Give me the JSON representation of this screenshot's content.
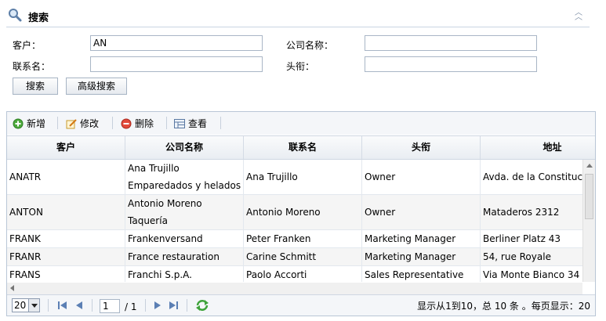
{
  "search": {
    "title": "搜索",
    "customer_label": "客户：",
    "customer_value": "AN",
    "company_label": "公司名称：",
    "company_value": "",
    "contact_label": "联系名：",
    "contact_value": "",
    "title_label": "头衔：",
    "title_value": "",
    "search_button": "搜索",
    "advanced_button": "高级搜索"
  },
  "toolbar": {
    "add": "新增",
    "edit": "修改",
    "delete": "删除",
    "view": "查看"
  },
  "columns": [
    "客户",
    "公司名称",
    "联系名",
    "头衔",
    "地址"
  ],
  "rows": [
    {
      "customer": "ANATR",
      "company": "Ana Trujillo Emparedados y helados",
      "contact": "Ana Trujillo",
      "title": "Owner",
      "address": "Avda. de la Constitución"
    },
    {
      "customer": "ANTON",
      "company": "Antonio Moreno Taquería",
      "contact": "Antonio Moreno",
      "title": "Owner",
      "address": "Mataderos 2312"
    },
    {
      "customer": "FRANK",
      "company": "Frankenversand",
      "contact": "Peter Franken",
      "title": "Marketing Manager",
      "address": "Berliner Platz 43"
    },
    {
      "customer": "FRANR",
      "company": "France restauration",
      "contact": "Carine Schmitt",
      "title": "Marketing Manager",
      "address": "54, rue Royale"
    },
    {
      "customer": "FRANS",
      "company": "Franchi S.p.A.",
      "contact": "Paolo Accorti",
      "title": "Sales Representative",
      "address": "Via Monte Bianco 34"
    }
  ],
  "pager": {
    "page_size": "20",
    "current_page": "1",
    "total_pages": "/ 1",
    "summary": "显示从1到10，总 10 条 。每页显示：20"
  }
}
